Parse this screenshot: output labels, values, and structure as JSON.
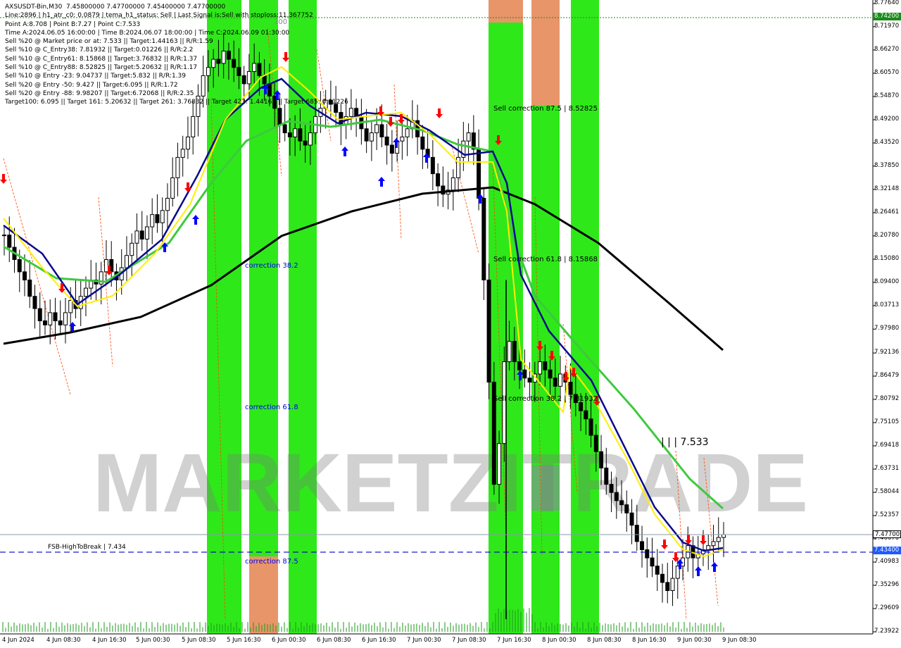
{
  "header": {
    "lines": [
      "AXSUSDT-Bin,M30  7.45800000 7.47700000 7.45400000 7.47700000",
      "Line:2896 | h1_atr_c0: 0.0879 | tema_h1_status: Sell | Last Signal is:Sell with stoploss:11.367752",
      "Point A:8.708 | Point B:7.27 | Point C:7.533",
      "Time A:2024.06.05 16:00:00 | Time B:2024.06.07 18:00:00 | Time C:2024.06.09 01:30:00",
      "Sell %20 @ Market price or at: 7.533 || Target:1.44163 || R/R:1.59",
      "Sell %10 @ C_Entry38: 7.81932 || Target:0.01226 || R/R:2.2",
      "Sell %10 @ C_Entry61: 8.15868 || Target:3.76832 || R/R:1.37",
      "Sell %10 @ C_Entry88: 8.52825 || Target:5.20632 || R/R:1.17",
      "Sell %10 @ Entry -23: 9.04737 || Target:5.832 || R/R:1.39",
      "Sell %20 @ Entry -50: 9.427 || Target:6.095 || R/R:1.72",
      "Sell %20 @ Entry -88: 9.98207 || Target:6.72068 || R/R:2.35",
      "Target100: 6.095 || Target 161: 5.20632 || Target 261: 3.76832 || Target 423: 1.44163 || Target 685: 0.01226"
    ]
  },
  "labels": {
    "correction_382": "correction 38.2",
    "correction_618": "correction 61.8",
    "correction_875": "correction 87.5",
    "sell_correction_875": "Sell correction 87.5 | 8.52825",
    "sell_correction_618": "Sell correction 61.8 | 8.15868",
    "sell_correction_382": "Sell correction 38.2 | 7.81932",
    "point_c": "| | | 7.533",
    "fsb": "FSB-HighToBreak | 7.434",
    "top_100": "100"
  },
  "watermark": "MARKETZITRADE",
  "colors": {
    "background": "#ffffff",
    "zone_green": "#2fe81a",
    "zone_orange": "#e8956a",
    "ma_black": "#000000",
    "ma_blue": "#0a0a8c",
    "ma_green": "#3ec93e",
    "ma_yellow": "#ffee00",
    "sell_arrow": "#ff0000",
    "buy_arrow": "#0000ff",
    "level_line": "#0000cc",
    "badge_green": "#1a8a1a",
    "badge_blue": "#1e5aff"
  },
  "badges": {
    "top": "8.74200",
    "current": "7.47700",
    "fsb": "7.43400"
  },
  "chart_data": {
    "type": "candlestick",
    "symbol": "AXSUSDT-Bin",
    "timeframe": "M30",
    "ylim": [
      7.2392,
      8.7764
    ],
    "price_ticks": [
      "8.77640",
      "8.71970",
      "8.66270",
      "8.60570",
      "8.54870",
      "8.49200",
      "8.43520",
      "8.37850",
      "8.32148",
      "8.26461",
      "8.20780",
      "8.15080",
      "8.09400",
      "8.03713",
      "7.97980",
      "7.92136",
      "7.86479",
      "7.80792",
      "7.75105",
      "7.69418",
      "7.63731",
      "7.58044",
      "7.52357",
      "7.46670",
      "7.40983",
      "7.35296",
      "7.29609",
      "7.23922"
    ],
    "time_ticks": [
      "4 Jun 2024",
      "4 Jun 08:30",
      "4 Jun 16:30",
      "5 Jun 00:30",
      "5 Jun 08:30",
      "5 Jun 16:30",
      "6 Jun 00:30",
      "6 Jun 08:30",
      "6 Jun 16:30",
      "7 Jun 00:30",
      "7 Jun 08:30",
      "7 Jun 16:30",
      "8 Jun 00:30",
      "8 Jun 08:30",
      "8 Jun 16:30",
      "9 Jun 00:30",
      "9 Jun 08:30"
    ],
    "levels": {
      "top_dotted": 8.742,
      "current": 7.477,
      "fsb_high_to_break": 7.434
    },
    "point_a": 8.708,
    "point_b": 7.27,
    "point_c": 7.533,
    "close": [
      8.21,
      8.18,
      8.15,
      8.12,
      8.1,
      8.06,
      8.03,
      8.0,
      7.99,
      8.02,
      8.0,
      7.99,
      8.02,
      8.05,
      8.03,
      8.06,
      8.08,
      8.1,
      8.09,
      8.12,
      8.15,
      8.12,
      8.1,
      8.13,
      8.16,
      8.19,
      8.22,
      8.2,
      8.23,
      8.26,
      8.24,
      8.27,
      8.3,
      8.35,
      8.4,
      8.42,
      8.45,
      8.5,
      8.55,
      8.6,
      8.62,
      8.64,
      8.63,
      8.66,
      8.64,
      8.62,
      8.6,
      8.58,
      8.61,
      8.63,
      8.6,
      8.58,
      8.55,
      8.52,
      8.48,
      8.46,
      8.45,
      8.47,
      8.44,
      8.43,
      8.46,
      8.5,
      8.52,
      8.54,
      8.53,
      8.51,
      8.48,
      8.5,
      8.52,
      8.5,
      8.47,
      8.44,
      8.46,
      8.48,
      8.45,
      8.43,
      8.41,
      8.44,
      8.45,
      8.47,
      8.49,
      8.45,
      8.42,
      8.4,
      8.36,
      8.33,
      8.31,
      8.32,
      8.35,
      8.4,
      8.44,
      8.46,
      8.42,
      8.3,
      8.1,
      7.85,
      7.6,
      7.7,
      7.9,
      7.95,
      7.9,
      7.88,
      7.86,
      7.85,
      7.87,
      7.9,
      7.88,
      7.86,
      7.84,
      7.87,
      7.85,
      7.82,
      7.8,
      7.78,
      7.76,
      7.72,
      7.68,
      7.64,
      7.6,
      7.58,
      7.56,
      7.55,
      7.53,
      7.5,
      7.46,
      7.44,
      7.42,
      7.4,
      7.38,
      7.36,
      7.34,
      7.37,
      7.4,
      7.42,
      7.45,
      7.42,
      7.43,
      7.44,
      7.45,
      7.46,
      7.47,
      7.477
    ]
  }
}
